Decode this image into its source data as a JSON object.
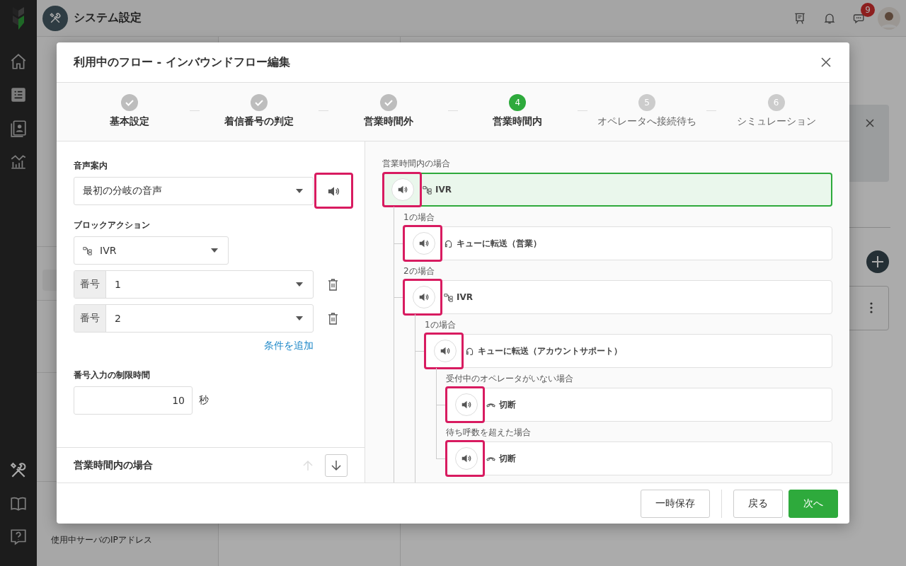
{
  "app": {
    "title": "システム設定",
    "notification_count": "9"
  },
  "sidebar": {
    "footer_item": "使用中サーバのIPアドレス"
  },
  "dialog": {
    "title": "利用中のフロー - インバウンドフロー編集",
    "steps": [
      {
        "label": "基本設定",
        "completed": true,
        "selected": false
      },
      {
        "label": "着信番号の判定",
        "completed": true,
        "selected": false
      },
      {
        "label": "営業時間外",
        "completed": true,
        "selected": false
      },
      {
        "label": "営業時間内",
        "number": "4",
        "completed": false,
        "selected": true
      },
      {
        "label": "オペレータへ接続待ち",
        "number": "5",
        "completed": false,
        "selected": false
      },
      {
        "label": "シミュレーション",
        "number": "6",
        "completed": false,
        "selected": false
      }
    ],
    "form": {
      "voice_label": "音声案内",
      "voice_value": "最初の分岐の音声",
      "voice_highlighted": true,
      "action_label": "ブロックアクション",
      "action_value": "IVR",
      "conditions": [
        {
          "addon": "番号",
          "value": "1"
        },
        {
          "addon": "番号",
          "value": "2"
        }
      ],
      "add_condition": "条件を追加",
      "timeout_label": "番号入力の制限時間",
      "timeout_value": "10",
      "timeout_unit": "秒"
    },
    "section_bar": {
      "title": "営業時間内の場合",
      "move_up": {
        "disabled": true
      },
      "move_down": {
        "disabled": false
      }
    },
    "flow": {
      "nodes": [
        {
          "condition": "営業時間内の場合",
          "kind": "ivr",
          "label": "IVR",
          "selected": true,
          "highlighted": true,
          "continues": true,
          "children": [
            {
              "condition": "1の場合",
              "kind": "queue",
              "label": "キューに転送（営業）",
              "selected": false,
              "highlighted": true
            },
            {
              "condition": "2の場合",
              "kind": "ivr",
              "label": "IVR",
              "selected": false,
              "highlighted": true,
              "continues": true,
              "children": [
                {
                  "condition": "1の場合",
                  "kind": "queue",
                  "label": "キューに転送（アカウントサポート）",
                  "selected": false,
                  "highlighted": true,
                  "continues": false,
                  "children": [
                    {
                      "condition": "受付中のオペレータがいない場合",
                      "kind": "hangup",
                      "label": "切断",
                      "selected": false,
                      "highlighted": true
                    },
                    {
                      "condition": "待ち呼数を超えた場合",
                      "kind": "hangup",
                      "label": "切断",
                      "selected": false,
                      "highlighted": true
                    }
                  ]
                }
              ]
            }
          ]
        }
      ]
    },
    "buttons": {
      "save": "一時保存",
      "back": "戻る",
      "next": "次へ"
    }
  }
}
